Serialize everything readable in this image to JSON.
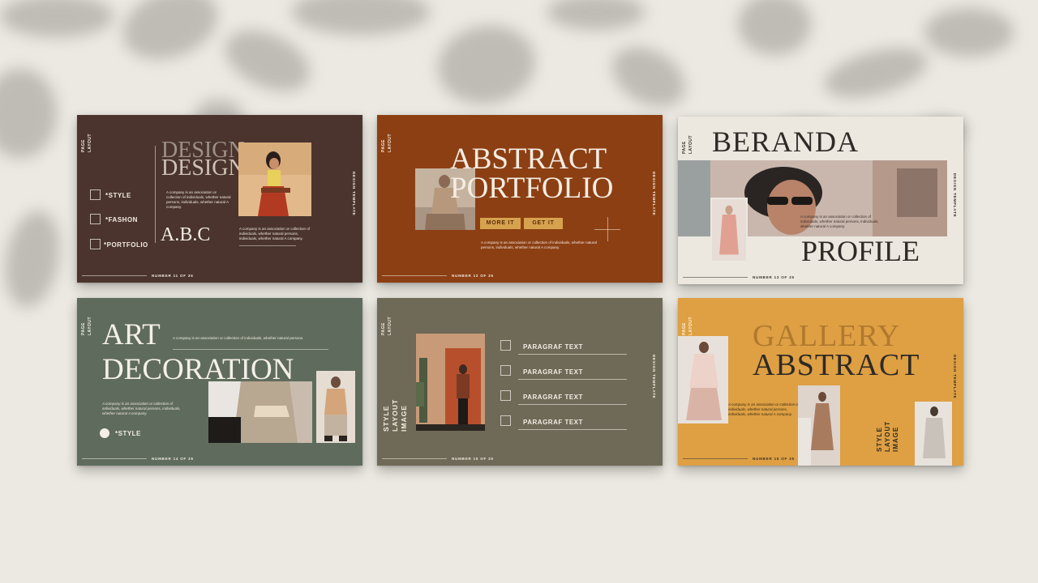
{
  "slides": [
    {
      "id": "slide-1",
      "side_label": "PAGE LAYOUT",
      "title_1": "DESIGN",
      "title_2": "DESIGN",
      "subtitle": "A.B.C",
      "body_1": "A company is an association or collection of individuals, whether natural persons, individuals, whether natural A company.",
      "body_2": "A company is an association or collection of individuals, whether natural persons, individuals, whether natural A company.",
      "checklist": [
        "*STYLE",
        "*FASHON",
        "*PORTFOLIO"
      ],
      "right_label": "DESIGN TEMPLATE",
      "number": "NUMBER 11 OF 35"
    },
    {
      "id": "slide-2",
      "side_label": "PAGE LAYOUT",
      "title_1": "ABSTRACT",
      "title_2": "PORTFOLIO",
      "button_1": "MORE IT",
      "button_2": "GET IT",
      "body": "A company is an association or collection of individuals, whether natural persons, individuals, whether natural A company.",
      "right_label": "DESIGN TEMPLATE",
      "number": "NUMBER 12 OF 35"
    },
    {
      "id": "slide-3",
      "side_label": "PAGE LAYOUT",
      "title_1": "BERANDA",
      "title_2": "PROFILE",
      "body": "A company is an association or collection of individuals, whether natural persons, individuals, whether natural A company.",
      "right_label": "DESIGN TEMPLATE",
      "number": "NUMBER 13 OF 35"
    },
    {
      "id": "slide-4",
      "side_label": "PAGE LAYOUT",
      "title_1": "ART",
      "title_2": "DECORATION",
      "body_1": "A company is an association or collection of individuals, whether natural persons.",
      "body_2": "A company is an association or collection of individuals, whether natural persons, individuals, whether natural A company.",
      "option": "*STYLE",
      "number": "NUMBER 14 OF 35"
    },
    {
      "id": "slide-5",
      "side_label": "PAGE LAYOUT",
      "vertical_title": "STYLE LAYOUT IMAGE",
      "items": [
        "PARAGRAF TEXT",
        "PARAGRAF TEXT",
        "PARAGRAF TEXT",
        "PARAGRAF TEXT"
      ],
      "right_label": "DESIGN TEMPLATE",
      "number": "NUMBER 15 OF 35"
    },
    {
      "id": "slide-6",
      "side_label": "PAGE LAYOUT",
      "title_1": "GALLERY",
      "title_2": "ABSTRACT",
      "body": "A company is an association or collection of individuals, whether natural persons, individuals, whether natural A company.",
      "vertical_title": "STYLE LAYOUT IMAGE",
      "right_label": "DESIGN TEMPLATE",
      "number": "NUMBER 16 OF 35"
    }
  ],
  "colors": {
    "background": "#ebe9e1",
    "slide_1": "#4a342d",
    "slide_2": "#8c3f13",
    "slide_3": "#ece8e0",
    "slide_4": "#5f6c5d",
    "slide_5": "#6f6957",
    "slide_6": "#dea043",
    "button_gold": "#d7a24e"
  }
}
